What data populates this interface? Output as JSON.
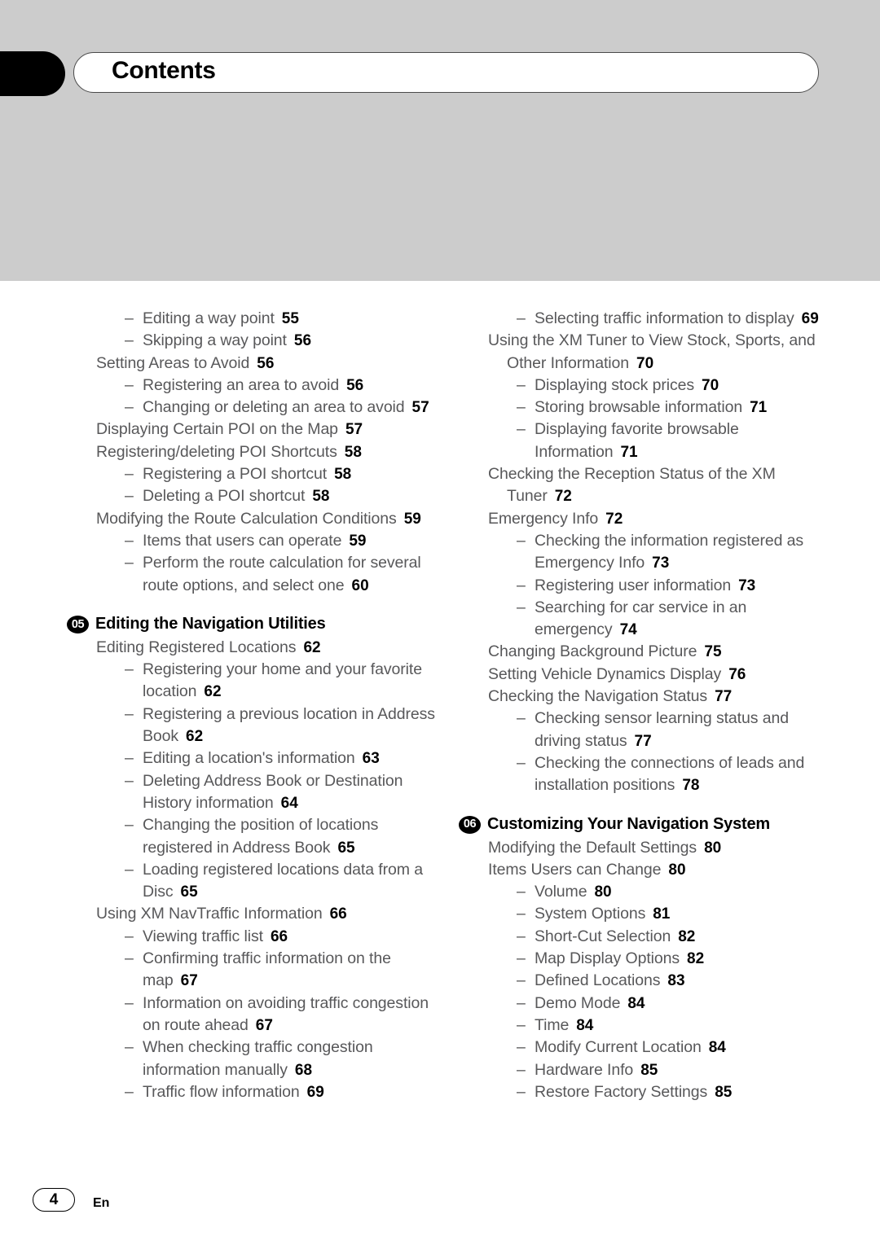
{
  "header": {
    "title": "Contents",
    "tab_marker": "black-tab"
  },
  "footer": {
    "page_number": "4",
    "language": "En"
  },
  "columns": {
    "left": [
      {
        "level": 2,
        "label": "Editing a way point",
        "page": "55"
      },
      {
        "level": 2,
        "label": "Skipping a way point",
        "page": "56"
      },
      {
        "level": 1,
        "label": "Setting Areas to Avoid",
        "page": "56"
      },
      {
        "level": 2,
        "label": "Registering an area to avoid",
        "page": "56"
      },
      {
        "level": 2,
        "label": "Changing or deleting an area to avoid",
        "page": "57"
      },
      {
        "level": 1,
        "label": "Displaying Certain POI on the Map",
        "page": "57"
      },
      {
        "level": 1,
        "label": "Registering/deleting POI Shortcuts",
        "page": "58"
      },
      {
        "level": 2,
        "label": "Registering a POI shortcut",
        "page": "58"
      },
      {
        "level": 2,
        "label": "Deleting a POI shortcut",
        "page": "58"
      },
      {
        "level": 1,
        "label": "Modifying the Route Calculation Conditions",
        "page": "59"
      },
      {
        "level": 2,
        "label": "Items that users can operate",
        "page": "59"
      },
      {
        "level": 2,
        "label": "Perform the route calculation for several route options, and select one",
        "page": "60"
      },
      {
        "level": 0,
        "number": "05",
        "label": "Editing the Navigation Utilities"
      },
      {
        "level": 1,
        "label": "Editing Registered Locations",
        "page": "62"
      },
      {
        "level": 2,
        "label": "Registering your home and your favorite location",
        "page": "62"
      },
      {
        "level": 2,
        "label": "Registering a previous location in Address Book",
        "page": "62"
      },
      {
        "level": 2,
        "label": "Editing a location's information",
        "page": "63"
      },
      {
        "level": 2,
        "label": "Deleting Address Book or Destination History information",
        "page": "64"
      },
      {
        "level": 2,
        "label": "Changing the position of locations registered in Address Book",
        "page": "65"
      },
      {
        "level": 2,
        "label": "Loading registered locations data from a Disc",
        "page": "65"
      },
      {
        "level": 1,
        "label": "Using XM NavTraffic Information",
        "page": "66"
      },
      {
        "level": 2,
        "label": "Viewing traffic list",
        "page": "66"
      },
      {
        "level": 2,
        "label": "Confirming traffic information on the map",
        "page": "67"
      },
      {
        "level": 2,
        "label": "Information on avoiding traffic congestion on route ahead",
        "page": "67"
      },
      {
        "level": 2,
        "label": "When checking traffic congestion information manually",
        "page": "68"
      },
      {
        "level": 2,
        "label": "Traffic flow information",
        "page": "69"
      }
    ],
    "right": [
      {
        "level": 2,
        "label": "Selecting traffic information to display",
        "page": "69"
      },
      {
        "level": 1,
        "label": "Using the XM Tuner to View Stock, Sports, and Other Information",
        "page": "70"
      },
      {
        "level": 2,
        "label": "Displaying stock prices",
        "page": "70"
      },
      {
        "level": 2,
        "label": "Storing browsable information",
        "page": "71"
      },
      {
        "level": 2,
        "label": "Displaying favorite browsable Information",
        "page": "71"
      },
      {
        "level": 1,
        "label": "Checking the Reception Status of the XM Tuner",
        "page": "72"
      },
      {
        "level": 1,
        "label": "Emergency Info",
        "page": "72"
      },
      {
        "level": 2,
        "label": "Checking the information registered as Emergency Info",
        "page": "73"
      },
      {
        "level": 2,
        "label": "Registering user information",
        "page": "73"
      },
      {
        "level": 2,
        "label": "Searching for car service in an emergency",
        "page": "74"
      },
      {
        "level": 1,
        "label": "Changing Background Picture",
        "page": "75"
      },
      {
        "level": 1,
        "label": "Setting Vehicle Dynamics Display",
        "page": "76"
      },
      {
        "level": 1,
        "label": "Checking the Navigation Status",
        "page": "77"
      },
      {
        "level": 2,
        "label": "Checking sensor learning status and driving status",
        "page": "77"
      },
      {
        "level": 2,
        "label": "Checking the connections of leads and installation positions",
        "page": "78"
      },
      {
        "level": 0,
        "number": "06",
        "label": "Customizing Your Navigation System"
      },
      {
        "level": 1,
        "label": "Modifying the Default Settings",
        "page": "80"
      },
      {
        "level": 1,
        "label": "Items Users can Change",
        "page": "80"
      },
      {
        "level": 2,
        "label": "Volume",
        "page": "80"
      },
      {
        "level": 2,
        "label": "System Options",
        "page": "81"
      },
      {
        "level": 2,
        "label": "Short-Cut Selection",
        "page": "82"
      },
      {
        "level": 2,
        "label": "Map Display Options",
        "page": "82"
      },
      {
        "level": 2,
        "label": "Defined Locations",
        "page": "83"
      },
      {
        "level": 2,
        "label": "Demo Mode",
        "page": "84"
      },
      {
        "level": 2,
        "label": "Time",
        "page": "84"
      },
      {
        "level": 2,
        "label": "Modify Current Location",
        "page": "84"
      },
      {
        "level": 2,
        "label": "Hardware Info",
        "page": "85"
      },
      {
        "level": 2,
        "label": "Restore Factory Settings",
        "page": "85"
      }
    ]
  }
}
